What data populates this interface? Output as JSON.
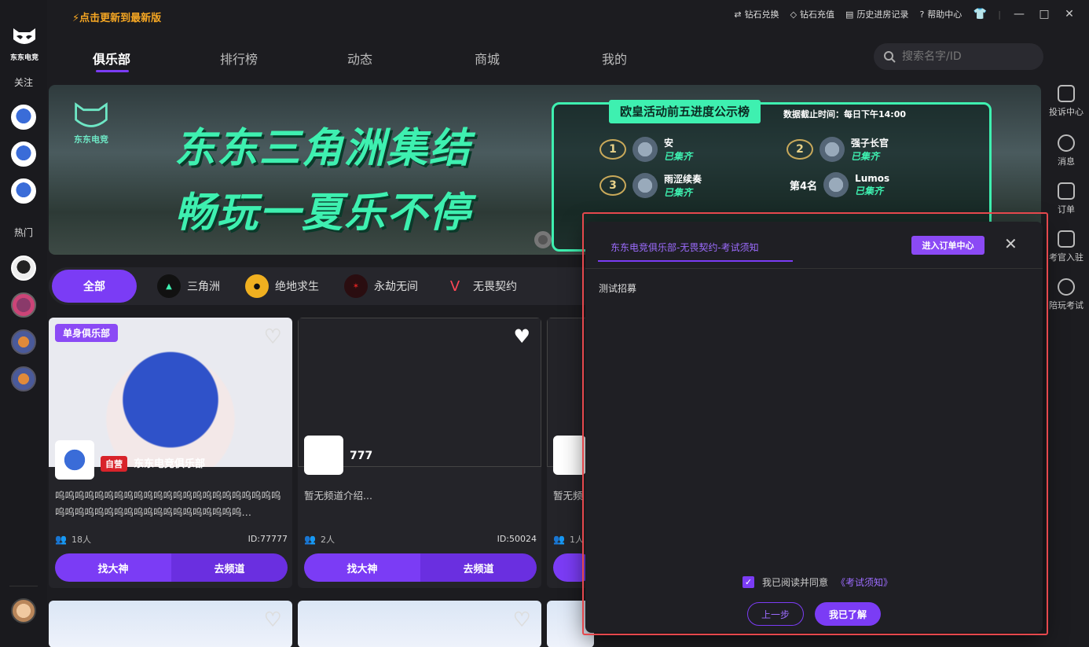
{
  "topbar": {
    "update_text": "点击更新到最新版",
    "actions": [
      {
        "icon": "exchange-icon",
        "label": "钻石兑换"
      },
      {
        "icon": "diamond-icon",
        "label": "钻石充值"
      },
      {
        "icon": "history-icon",
        "label": "历史进房记录"
      },
      {
        "icon": "help-icon",
        "label": "帮助中心"
      }
    ]
  },
  "brand": {
    "name": "东东电竞"
  },
  "sidebar": {
    "follow_label": "关注",
    "hot_label": "热门"
  },
  "nav": {
    "items": [
      "俱乐部",
      "排行榜",
      "动态",
      "商城",
      "我的"
    ],
    "active": "俱乐部"
  },
  "search": {
    "placeholder": "搜索名字/ID"
  },
  "banner": {
    "logo_text": "东东电竞",
    "title_line1": "东东三角洲集结",
    "title_line2": "畅玩一夏乐不停",
    "board_title": "欧皇活动前五进度公示榜",
    "board_note": "数据截止时间：每日下午14:00",
    "ranks": [
      {
        "rank": "1",
        "name": "安",
        "status": "已集齐"
      },
      {
        "rank": "2",
        "name": "强子长官",
        "status": "已集齐"
      },
      {
        "rank": "3",
        "name": "雨涩续奏",
        "status": "已集齐"
      },
      {
        "rank": "第4名",
        "name": "Lumos",
        "status": "已集齐"
      }
    ]
  },
  "categories": [
    {
      "label": "全部",
      "icon": ""
    },
    {
      "label": "三角洲",
      "icon": "delta-force-icon"
    },
    {
      "label": "绝地求生",
      "icon": "pubg-icon"
    },
    {
      "label": "永劫无间",
      "icon": "naraka-icon"
    },
    {
      "label": "无畏契约",
      "icon": "valorant-icon"
    }
  ],
  "cards": [
    {
      "badge": "单身俱乐部",
      "self_tag": "自营",
      "name": "东东电竞俱乐部",
      "desc": "呜呜呜呜呜呜呜呜呜呜呜呜呜呜呜呜呜呜呜呜呜呜呜呜呜呜呜呜呜呜呜呜呜呜呜呜呜呜呜呜呜呜…",
      "members": "18人",
      "id": "ID:77777",
      "btn_find": "找大神",
      "btn_go": "去频道"
    },
    {
      "name": "777",
      "desc": "暂无频道介绍...",
      "members": "2人",
      "id": "ID:50024",
      "btn_find": "找大神",
      "btn_go": "去频道"
    },
    {
      "desc": "暂无频",
      "members": "1人"
    }
  ],
  "right_sidebar": [
    {
      "icon": "complaint-icon",
      "label": "投诉中心"
    },
    {
      "icon": "message-icon",
      "label": "消息"
    },
    {
      "icon": "order-icon",
      "label": "订单"
    },
    {
      "icon": "examiner-icon",
      "label": "考官入驻"
    },
    {
      "icon": "exam-icon",
      "label": "陪玩考试"
    }
  ],
  "modal": {
    "tab": "东东电竞俱乐部-无畏契约-考试须知",
    "order_center": "进入订单中心",
    "body": "测试招募",
    "agree_text": "我已阅读并同意",
    "agree_link": "《考试须知》",
    "agreed": true,
    "prev": "上一步",
    "ok": "我已了解"
  },
  "colors": {
    "accent": "#7b3cf5",
    "banner_green": "#3ef0b0",
    "self_tag": "#d8232a",
    "highlight": "#e5484d"
  }
}
